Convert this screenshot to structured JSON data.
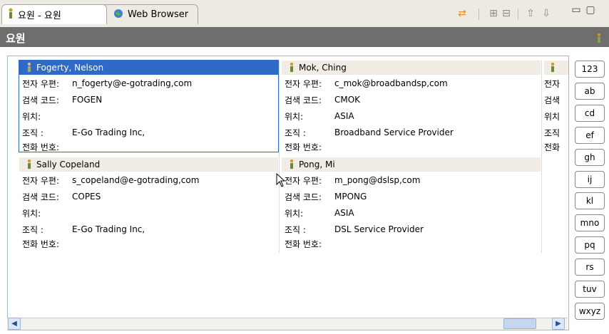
{
  "tabs": [
    {
      "label": "요원 - 요원",
      "icon": "person-icon"
    },
    {
      "label": "Web Browser",
      "icon": "globe-icon"
    }
  ],
  "toolbar": [
    {
      "name": "sync-icon"
    },
    {
      "name": "expand-all-icon"
    },
    {
      "name": "collapse-all-icon"
    },
    {
      "name": "up-arrow-icon"
    },
    {
      "name": "down-arrow-icon"
    },
    {
      "name": "minimize-icon"
    },
    {
      "name": "maximize-icon"
    }
  ],
  "view": {
    "title": "요원"
  },
  "labels": {
    "email": "전자 우편:",
    "search_code": "검색 코드:",
    "location": "위치:",
    "org": "조직 :",
    "phone": "전화 번호:"
  },
  "cards": [
    {
      "name": "Fogerty, Nelson",
      "email": "n_fogerty@e-gotrading,com",
      "code": "FOGEN",
      "location": "",
      "org": "E-Go Trading Inc,",
      "phone": "",
      "selected": true
    },
    {
      "name": "Mok, Ching",
      "email": "c_mok@broadbandsp,com",
      "code": "CMOK",
      "location": "ASIA",
      "org": "Broadband Service Provider",
      "phone": ""
    },
    {
      "name": "Sally Copeland",
      "email": "s_copeland@e-gotrading,com",
      "code": "COPES",
      "location": "",
      "org": "E-Go Trading Inc,",
      "phone": ""
    },
    {
      "name": "Pong, Mi",
      "email": "m_pong@dslsp,com",
      "code": "MPONG",
      "location": "ASIA",
      "org": "DSL Service Provider",
      "phone": ""
    }
  ],
  "partial_labels": [
    "전자",
    "검색",
    "위치",
    "조직",
    "전화"
  ],
  "alphabet": [
    "123",
    "ab",
    "cd",
    "ef",
    "gh",
    "ij",
    "kl",
    "mno",
    "pq",
    "rs",
    "tuv",
    "wxyz"
  ],
  "colors": {
    "selection": "#3169c6",
    "titlebar": "#6e6e6e"
  }
}
